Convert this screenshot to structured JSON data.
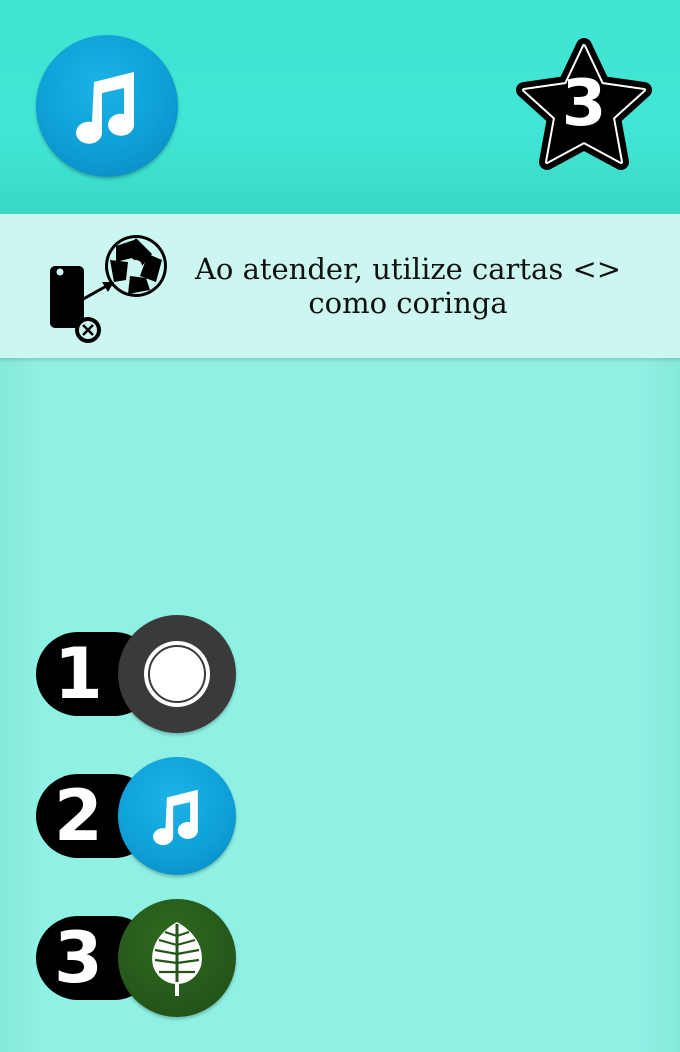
{
  "header": {
    "type_icon": "music-note-icon",
    "star_value": "3"
  },
  "rule": {
    "icon": "card-to-shutter-wildcard-icon",
    "text": "Ao atender, utilize cartas <> como coringa"
  },
  "ingredients": [
    {
      "count": "1",
      "icon": "white-circle-icon",
      "color": "#3a3a3a"
    },
    {
      "count": "2",
      "icon": "music-note-icon",
      "color": "#0d9fd6"
    },
    {
      "count": "3",
      "icon": "leaf-icon",
      "color": "#24561a"
    }
  ],
  "colors": {
    "header": "#42e6d6",
    "body": "#8ff1e4",
    "rule_band": "#ccf7f1",
    "music_blue": "#0d9fd6"
  }
}
